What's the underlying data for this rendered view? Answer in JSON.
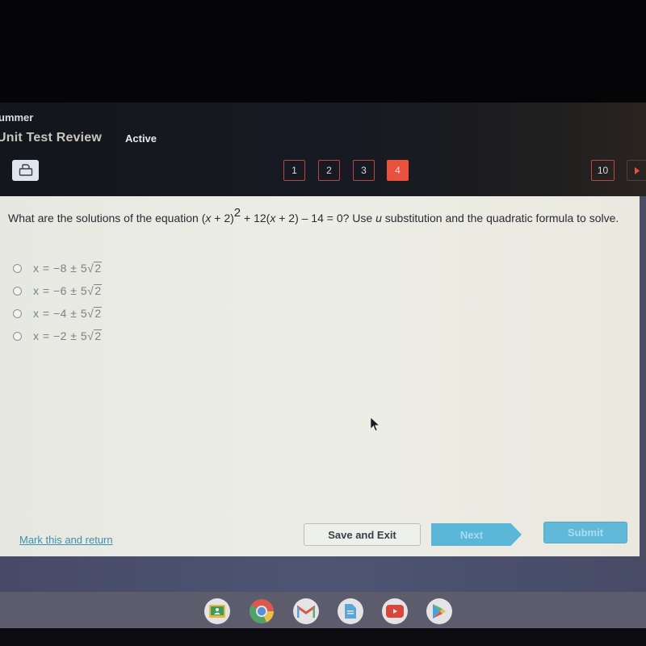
{
  "header": {
    "course_name": "ummer",
    "activity_title": "Unit Test Review",
    "status": "Active",
    "print_icon": "printer-icon"
  },
  "question_nav": {
    "items": [
      {
        "label": "1",
        "active": false
      },
      {
        "label": "2",
        "active": false
      },
      {
        "label": "3",
        "active": false
      },
      {
        "label": "4",
        "active": true
      },
      {
        "label": "10",
        "active": false
      }
    ],
    "next_icon": "triangle-right-icon",
    "active_color": "#e8513d"
  },
  "question": {
    "prefix": "What are the solutions of the equation (",
    "x1": "x",
    "part2": " + 2)",
    "exponent": "2",
    "part3": " + 12(",
    "x2": "x",
    "part4": " + 2) – 14 = 0? Use ",
    "u": "u",
    "suffix": " substitution and the quadratic formula to solve."
  },
  "answers": [
    {
      "prefix": "x = −8 ± 5",
      "radicand": "2"
    },
    {
      "prefix": "x = −6 ± 5",
      "radicand": "2"
    },
    {
      "prefix": "x = −4 ± 5",
      "radicand": "2"
    },
    {
      "prefix": "x = −2 ± 5",
      "radicand": "2"
    }
  ],
  "footer": {
    "mark_link": "Mark this and return",
    "save_exit": "Save and Exit",
    "next": "Next",
    "submit": "Submit",
    "button_color": "#5bb7d8"
  },
  "shelf": {
    "apps": [
      "google-classroom-icon",
      "chrome-icon",
      "gmail-icon",
      "google-docs-icon",
      "youtube-icon",
      "play-store-icon"
    ]
  }
}
